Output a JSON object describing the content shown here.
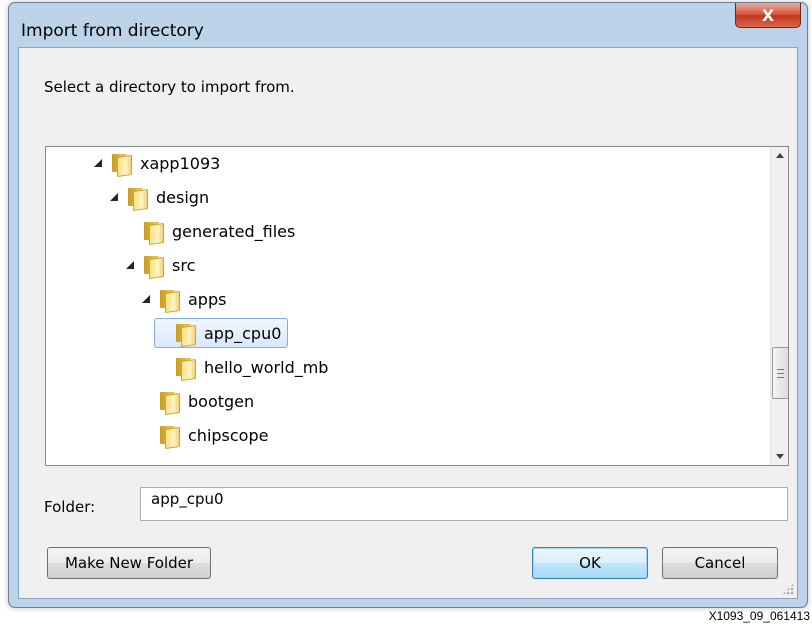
{
  "window": {
    "title": "Import from directory",
    "close_glyph": "X"
  },
  "instruction": "Select a directory to import from.",
  "tree": {
    "nodes": [
      {
        "label": "xapp1093",
        "depth": 0,
        "expanded": true,
        "selected": false,
        "icon": "folder-icon"
      },
      {
        "label": "design",
        "depth": 1,
        "expanded": true,
        "selected": false,
        "icon": "folder-icon"
      },
      {
        "label": "generated_files",
        "depth": 2,
        "expanded": false,
        "selected": false,
        "icon": "folder-icon"
      },
      {
        "label": "src",
        "depth": 2,
        "expanded": true,
        "selected": false,
        "icon": "folder-icon"
      },
      {
        "label": "apps",
        "depth": 3,
        "expanded": true,
        "selected": false,
        "icon": "folder-icon"
      },
      {
        "label": "app_cpu0",
        "depth": 4,
        "expanded": false,
        "selected": true,
        "icon": "folder-icon"
      },
      {
        "label": "hello_world_mb",
        "depth": 4,
        "expanded": false,
        "selected": false,
        "icon": "folder-icon"
      },
      {
        "label": "bootgen",
        "depth": 3,
        "expanded": false,
        "selected": false,
        "icon": "folder-icon"
      },
      {
        "label": "chipscope",
        "depth": 3,
        "expanded": false,
        "selected": false,
        "icon": "folder-icon"
      }
    ]
  },
  "folder": {
    "label": "Folder:",
    "value": "app_cpu0"
  },
  "buttons": {
    "make_new_folder": "Make New Folder",
    "ok": "OK",
    "cancel": "Cancel"
  },
  "caption": "X1093_09_061413"
}
